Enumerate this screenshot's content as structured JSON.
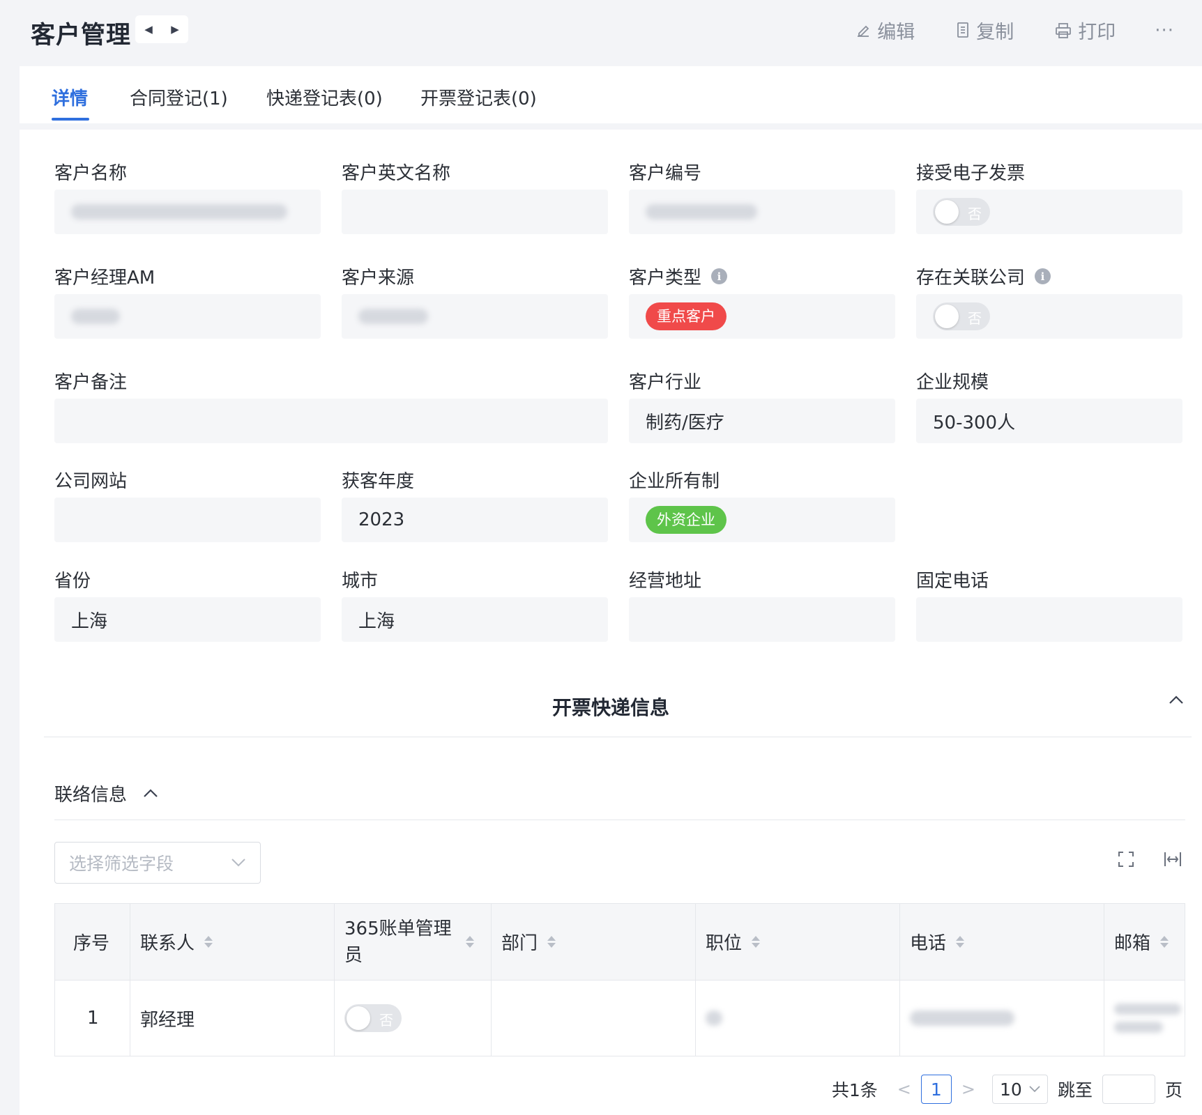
{
  "header": {
    "title": "客户管理",
    "prev_icon": "caret-left-icon",
    "next_icon": "caret-right-icon",
    "actions": {
      "edit": "编辑",
      "copy": "复制",
      "print": "打印",
      "more": "···"
    }
  },
  "tabs": [
    {
      "label": "详情",
      "active": true
    },
    {
      "label": "合同登记(1)",
      "active": false
    },
    {
      "label": "快递登记表(0)",
      "active": false
    },
    {
      "label": "开票登记表(0)",
      "active": false
    }
  ],
  "fields": {
    "customer_name": {
      "label": "客户名称",
      "value": ""
    },
    "customer_english_name": {
      "label": "客户英文名称",
      "value": ""
    },
    "customer_code": {
      "label": "客户编号",
      "value": ""
    },
    "accept_e_invoice": {
      "label": "接受电子发票",
      "toggle": "否",
      "on": false
    },
    "account_manager": {
      "label": "客户经理AM",
      "value": ""
    },
    "customer_source": {
      "label": "客户来源",
      "value": ""
    },
    "customer_type": {
      "label": "客户类型",
      "tag": "重点客户",
      "tag_color": "#f04a4a"
    },
    "has_related_company": {
      "label": "存在关联公司",
      "toggle": "否",
      "on": false
    },
    "customer_remark": {
      "label": "客户备注",
      "value": ""
    },
    "industry": {
      "label": "客户行业",
      "value": "制药/医疗"
    },
    "company_scale": {
      "label": "企业规模",
      "value": "50-300人"
    },
    "website": {
      "label": "公司网站",
      "value": ""
    },
    "acquisition_year": {
      "label": "获客年度",
      "value": "2023"
    },
    "ownership": {
      "label": "企业所有制",
      "tag": "外资企业",
      "tag_color": "#5ec44a"
    },
    "province": {
      "label": "省份",
      "value": "上海"
    },
    "city": {
      "label": "城市",
      "value": "上海"
    },
    "business_address": {
      "label": "经营地址",
      "value": ""
    },
    "landline": {
      "label": "固定电话",
      "value": ""
    }
  },
  "section": {
    "title": "开票快递信息"
  },
  "contacts": {
    "title": "联络信息",
    "filter_placeholder": "选择筛选字段",
    "columns": [
      "序号",
      "联系人",
      "365账单管理员",
      "部门",
      "职位",
      "电话",
      "邮箱"
    ],
    "rows": [
      {
        "index": "1",
        "contact": "郭经理",
        "bill_admin": "否",
        "dept": "",
        "position": "",
        "phone": "",
        "email": ""
      }
    ]
  },
  "pagination": {
    "total": "共1条",
    "current": "1",
    "page_size": "10",
    "jump_label": "跳至",
    "page_unit": "页"
  },
  "colors": {
    "accent": "#2f6fde",
    "danger": "#f04a4a",
    "success": "#5ec44a"
  }
}
